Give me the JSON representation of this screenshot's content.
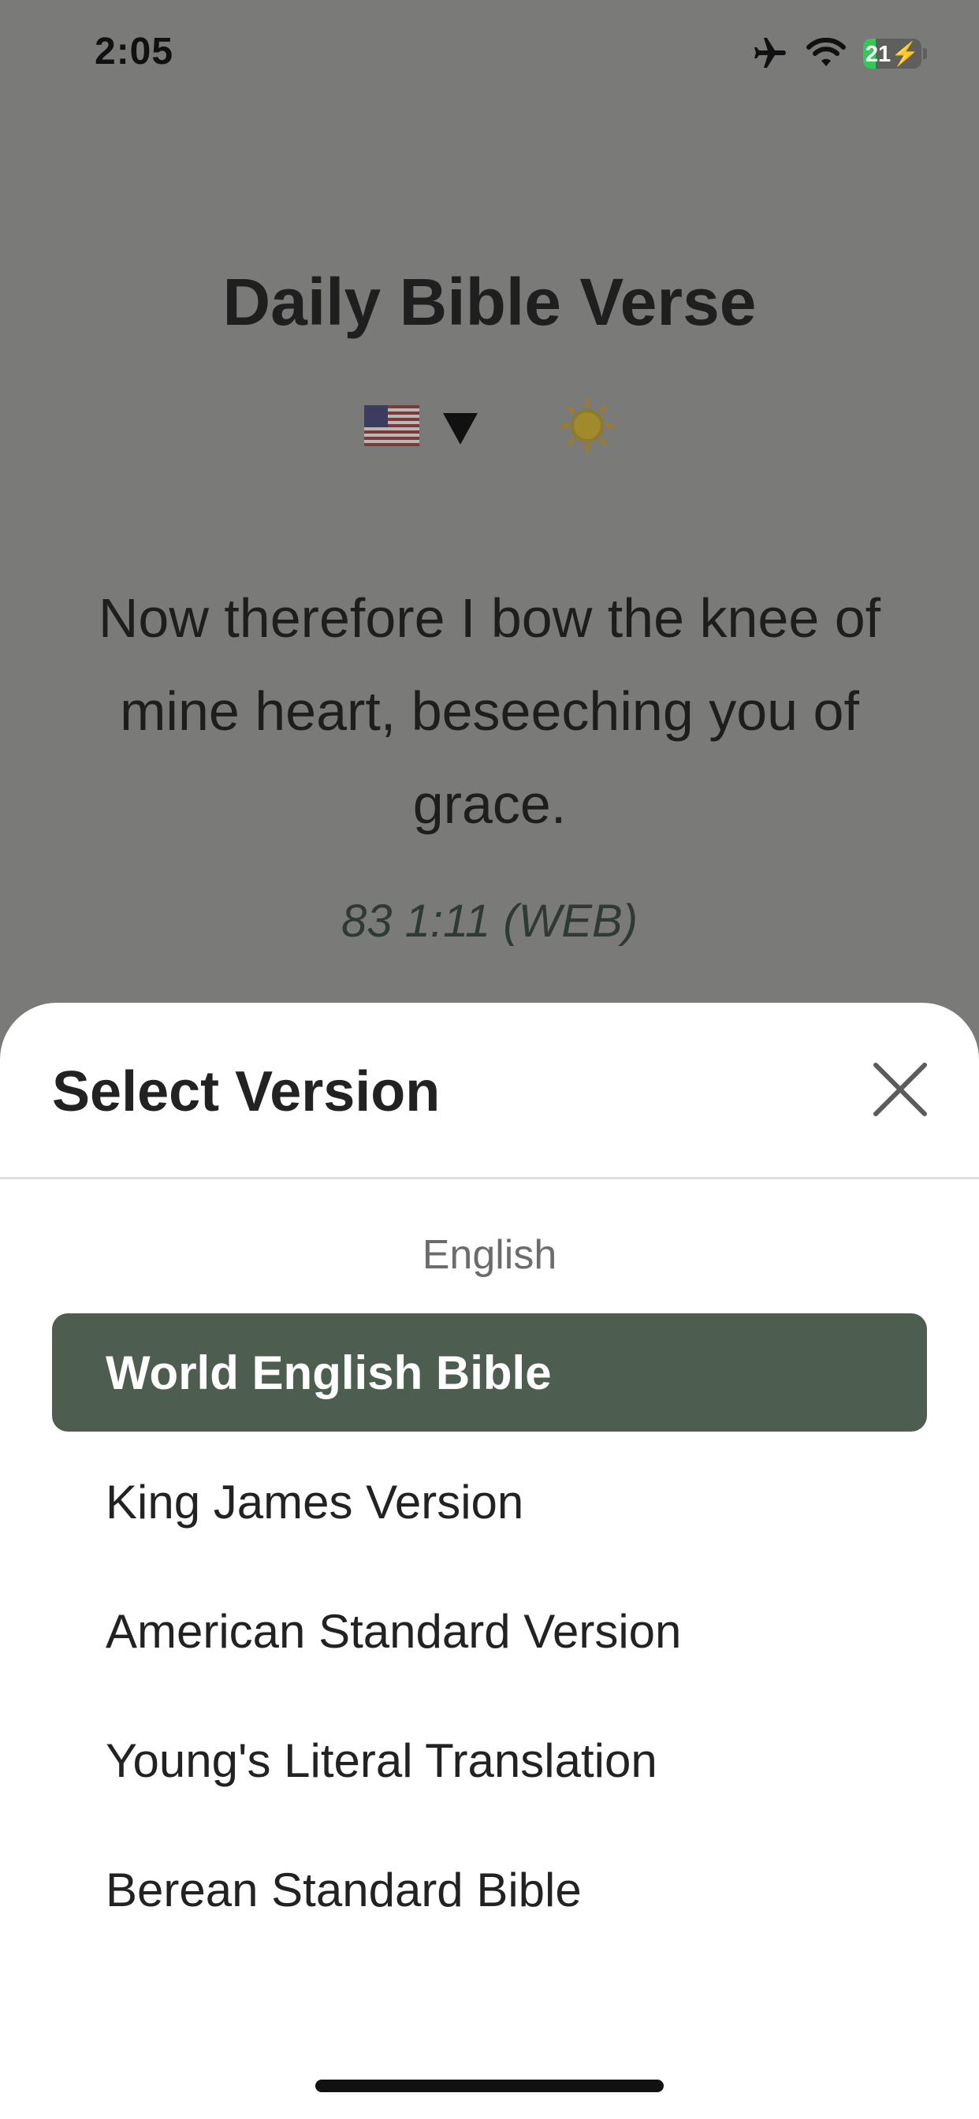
{
  "status_bar": {
    "time": "2:05",
    "battery_level": "21",
    "battery_fraction": 0.21,
    "icons": [
      "airplane-mode-icon",
      "wifi-icon",
      "battery-charging-icon"
    ]
  },
  "app": {
    "title": "Daily Bible Verse",
    "language_flag": "us-flag-icon",
    "theme_toggle": "sun-icon"
  },
  "verse": {
    "text": "Now therefore I bow the knee of mine heart, beseeching you of grace.",
    "reference": "83 1:11 (WEB)"
  },
  "sheet": {
    "title": "Select Version",
    "close_icon": "close-icon",
    "section_label": "English",
    "versions": [
      {
        "label": "World English Bible",
        "selected": true
      },
      {
        "label": "King James Version",
        "selected": false
      },
      {
        "label": "American Standard Version",
        "selected": false
      },
      {
        "label": "Young's Literal Translation",
        "selected": false
      },
      {
        "label": "Berean Standard Bible",
        "selected": false
      }
    ]
  },
  "colors": {
    "overlay_background": "#7a7b78",
    "selected_item": "#4d5e50",
    "battery_green": "#34c759"
  }
}
